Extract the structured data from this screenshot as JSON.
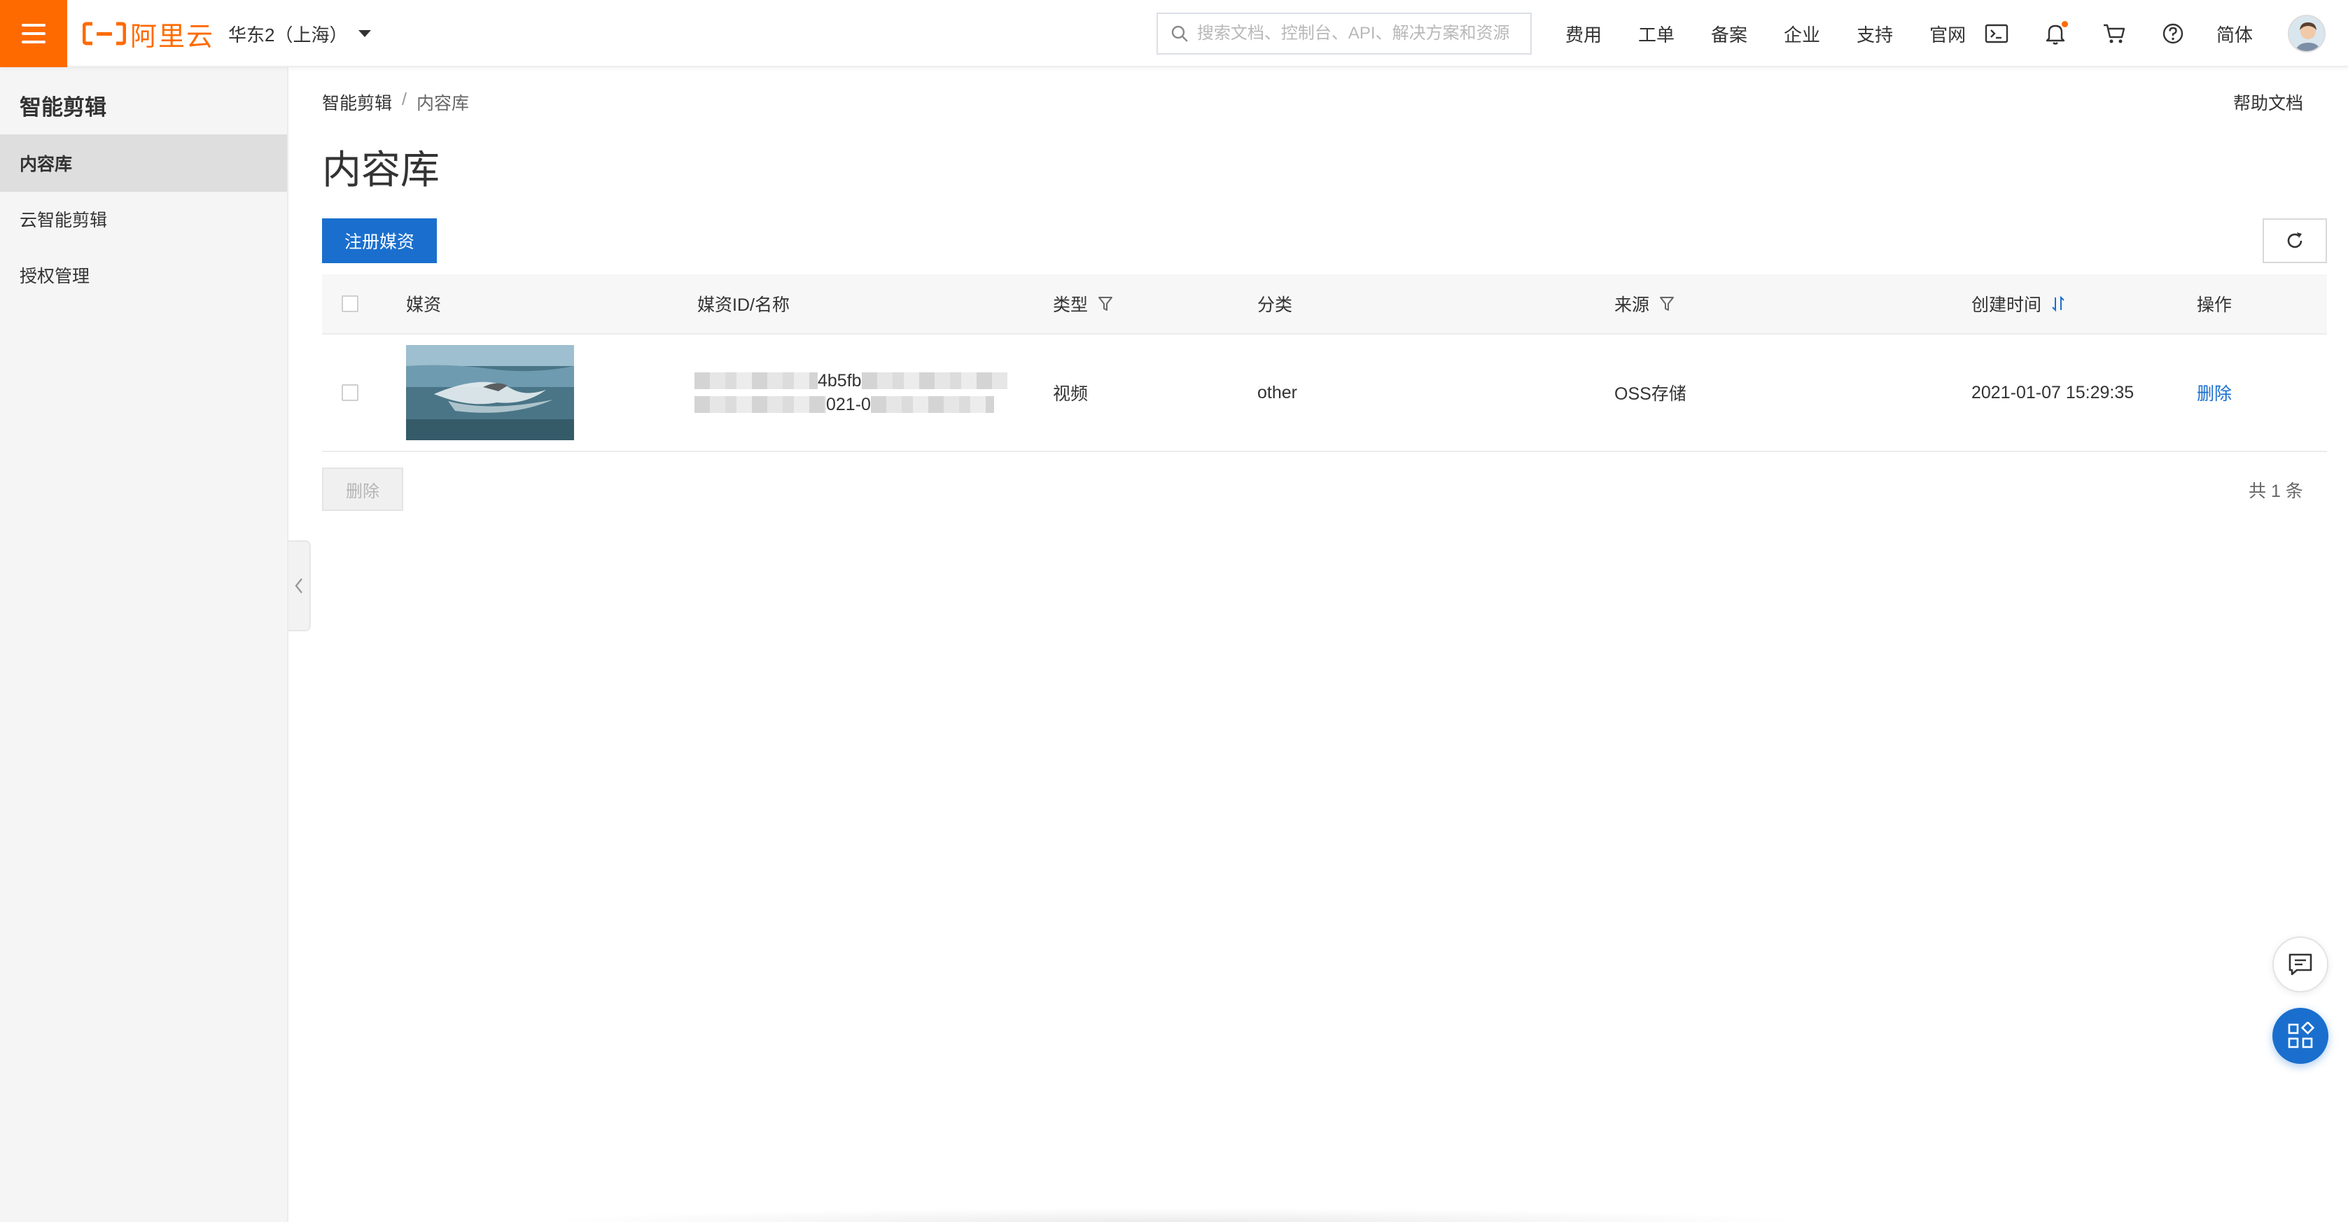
{
  "topbar": {
    "logo_text": "阿里云",
    "region": "华东2（上海）",
    "search_placeholder": "搜索文档、控制台、API、解决方案和资源",
    "nav": [
      "费用",
      "工单",
      "备案",
      "企业",
      "支持",
      "官网"
    ],
    "language": "简体",
    "icons": [
      "terminal-icon",
      "bell-icon",
      "cart-icon",
      "help-circle-icon"
    ]
  },
  "sidebar": {
    "title": "智能剪辑",
    "items": [
      {
        "label": "内容库",
        "active": true
      },
      {
        "label": "云智能剪辑",
        "active": false
      },
      {
        "label": "授权管理",
        "active": false
      }
    ]
  },
  "breadcrumb": {
    "root": "智能剪辑",
    "sep": "/",
    "current": "内容库"
  },
  "help_doc": "帮助文档",
  "page_title": "内容库",
  "actions": {
    "register": "注册媒资",
    "delete": "删除"
  },
  "table": {
    "columns": {
      "media": "媒资",
      "id_name": "媒资ID/名称",
      "type": "类型",
      "category": "分类",
      "source": "来源",
      "created": "创建时间",
      "operation": "操作"
    },
    "rows": [
      {
        "id_fragment": "4b5fb",
        "name_fragment": "021-0",
        "type": "视频",
        "category": "other",
        "source": "OSS存储",
        "created": "2021-01-07 15:29:35",
        "action": "删除"
      }
    ]
  },
  "pagination": {
    "total": "共 1 条"
  },
  "colors": {
    "brand_orange": "#ff6a00",
    "primary_blue": "#1a6fce"
  }
}
